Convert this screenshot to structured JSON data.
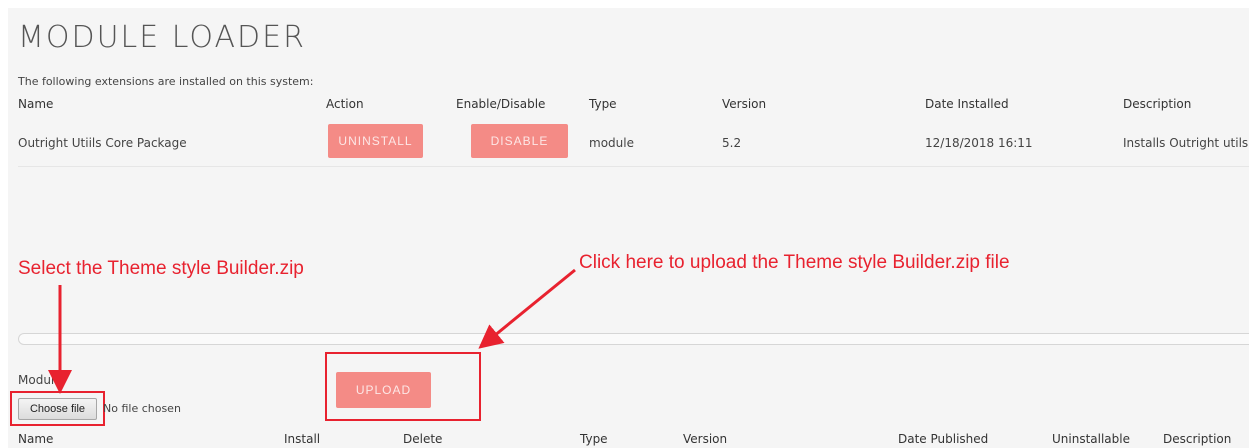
{
  "page": {
    "title": "MODULE LOADER",
    "intro": "The following extensions are installed on this system:"
  },
  "installed_table": {
    "headers": [
      "Name",
      "Action",
      "Enable/Disable",
      "Type",
      "Version",
      "Date Installed",
      "Description"
    ],
    "rows": [
      {
        "name": "Outright Utiils Core Package",
        "action_label": "UNINSTALL",
        "toggle_label": "DISABLE",
        "type": "module",
        "version": "5.2",
        "date_installed": "12/18/2018 16:11",
        "description": "Installs Outright utils"
      }
    ]
  },
  "annotations": {
    "left": "Select the Theme style Builder.zip",
    "right": "Click here to upload the Theme style Builder.zip file",
    "color": "#e8222f"
  },
  "upload": {
    "module_label": "Module",
    "choose_label": "Choose file",
    "no_file": "No file chosen",
    "upload_label": "UPLOAD"
  },
  "packages_table": {
    "headers": [
      "Name",
      "Install",
      "Delete",
      "Type",
      "Version",
      "Date Published",
      "Uninstallable",
      "Description"
    ]
  },
  "colors": {
    "button": "#f48b86",
    "button_text": "#fde7e6"
  }
}
